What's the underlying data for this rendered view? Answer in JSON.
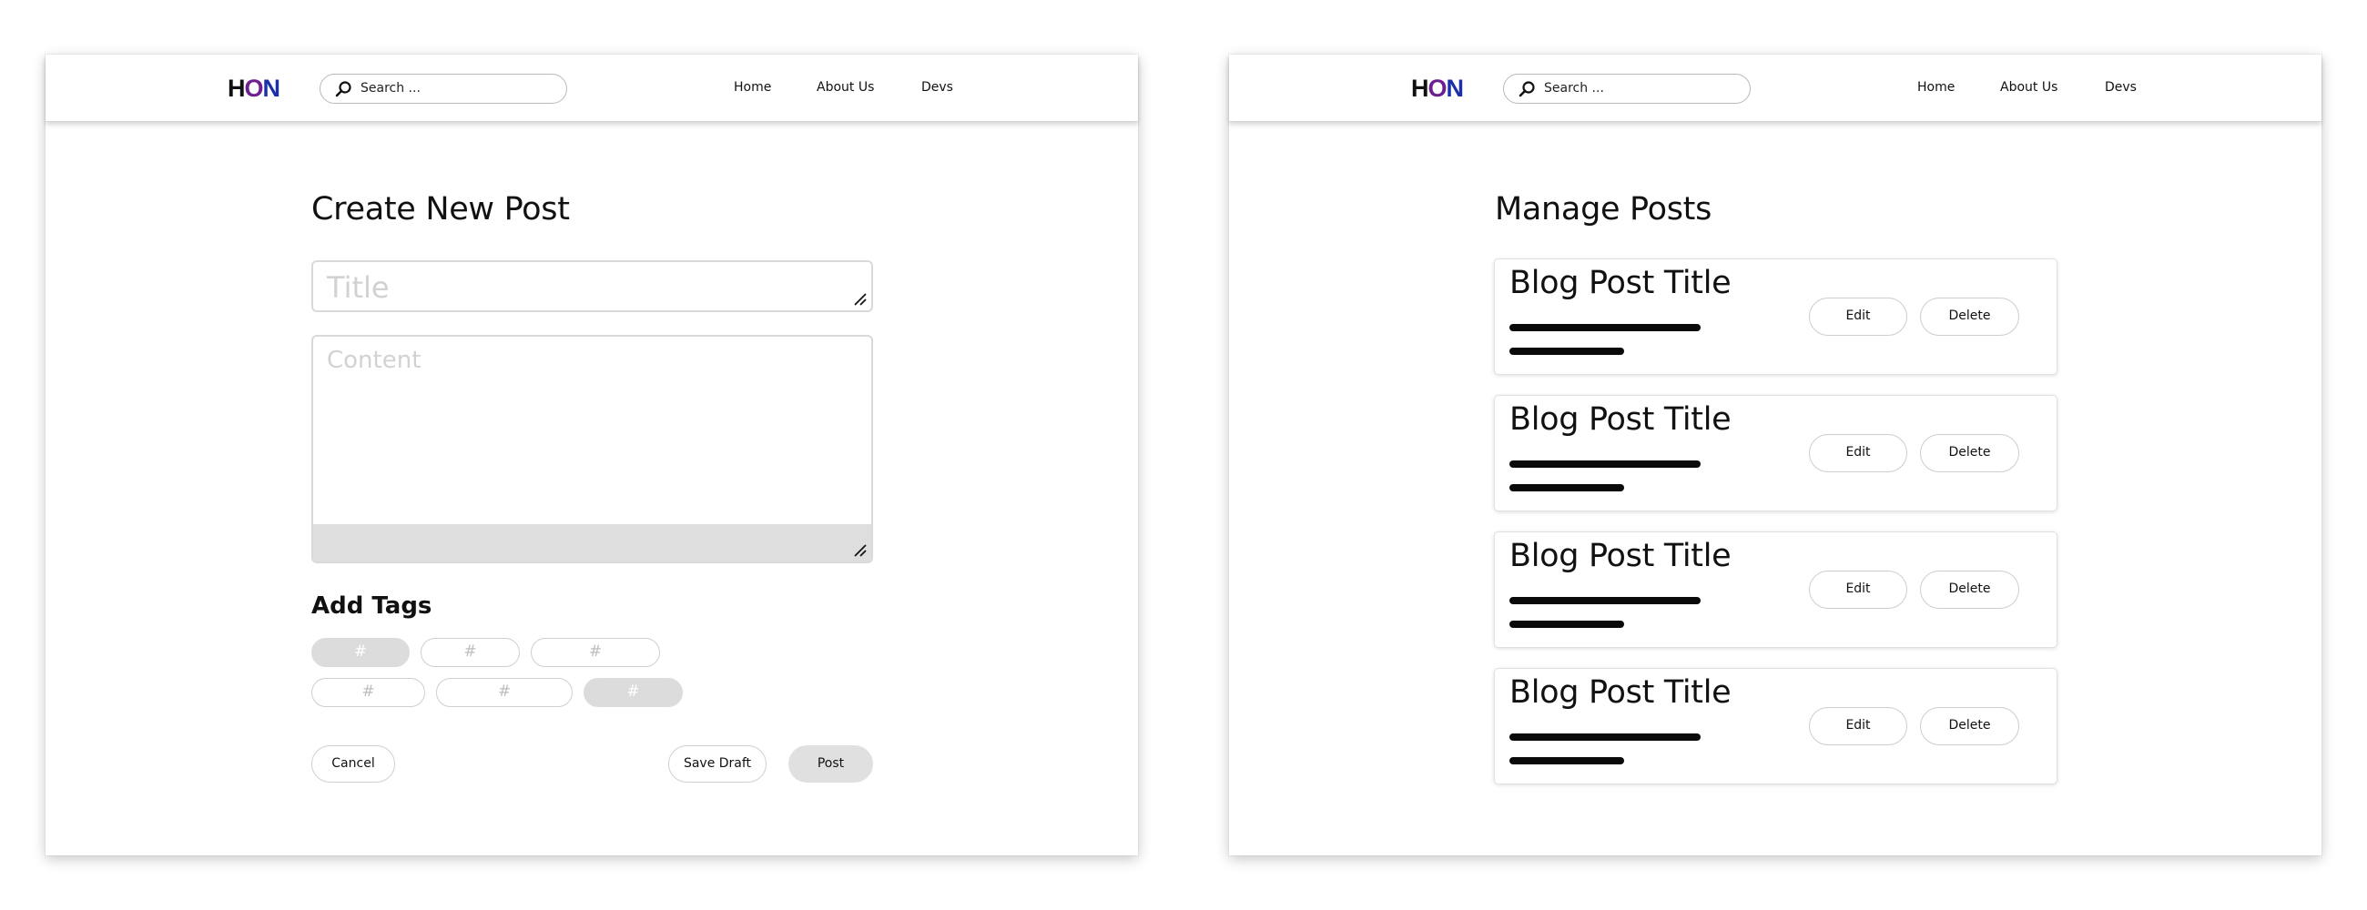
{
  "header": {
    "logo": {
      "h": "H",
      "o": "O",
      "n": "N"
    },
    "search_placeholder": "Search ...",
    "nav": [
      "Home",
      "About Us",
      "Devs"
    ]
  },
  "create_post": {
    "heading": "Create New Post",
    "title_placeholder": "Title",
    "content_placeholder": "Content",
    "tags_heading": "Add Tags",
    "tags": [
      "#",
      "#",
      "#",
      "#",
      "#",
      "#"
    ],
    "cancel_label": "Cancel",
    "save_draft_label": "Save Draft",
    "post_label": "Post"
  },
  "manage_posts": {
    "heading": "Manage Posts",
    "posts": [
      {
        "title": "Blog Post Title",
        "edit_label": "Edit",
        "delete_label": "Delete"
      },
      {
        "title": "Blog Post Title",
        "edit_label": "Edit",
        "delete_label": "Delete"
      },
      {
        "title": "Blog Post Title",
        "edit_label": "Edit",
        "delete_label": "Delete"
      },
      {
        "title": "Blog Post Title",
        "edit_label": "Edit",
        "delete_label": "Delete"
      }
    ]
  },
  "colors": {
    "logo_dark": "#111111",
    "logo_purple": "#6d1f8f",
    "logo_blue": "#1b2fa6",
    "filled_control": "#dcdcdc"
  }
}
